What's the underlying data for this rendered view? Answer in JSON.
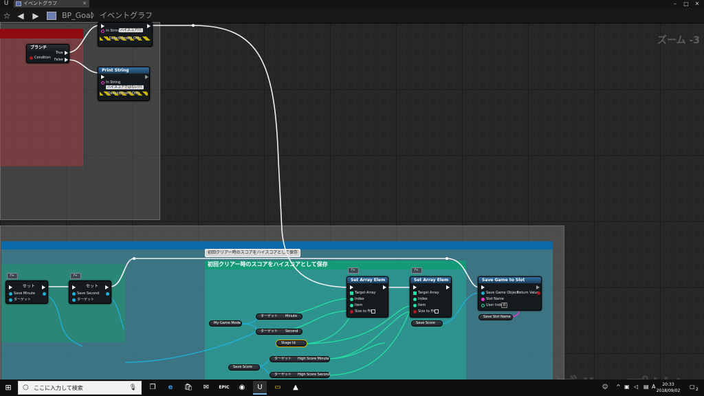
{
  "window": {
    "tab_title": "イベントグラフ",
    "breadcrumb": {
      "blueprint": "BP_Goal",
      "separator": "〉",
      "graph": "イベントグラフ"
    },
    "controls": {
      "minimize": "–",
      "maximize": "□",
      "close": "✕"
    }
  },
  "graph": {
    "zoom_label": "ズーム -3",
    "watermark": "ブループリント",
    "branch_node": {
      "title": "ブランチ",
      "condition": "Condition",
      "true": "True",
      "false": "False"
    },
    "print_string_top": {
      "in_string_label": "In String",
      "in_string_value": "ハイスコア!!!",
      "dev_only": "Development Only"
    },
    "print_string_bottom": {
      "title": "Print String",
      "in_string_label": "In String",
      "in_string_value": "ハイスコアではない!!!",
      "dev_only": "Development Only"
    },
    "comment": {
      "tooltip": "初回クリアー時のスコアをハイスコアとして保存",
      "title": "初回クリアー時のスコアをハイスコアとして保存"
    },
    "set_nodes": [
      {
        "badge": "f+",
        "title": "セット",
        "pin1": "Save Minute",
        "pin2": "ターゲット"
      },
      {
        "badge": "f+",
        "title": "セット",
        "pin1": "Save Second",
        "pin2": "ターゲット"
      }
    ],
    "set_array_nodes": [
      {
        "badge": "f+",
        "title": "Set Array Elem",
        "pins": [
          "Target Array",
          "Index",
          "Item",
          "Size to Fit"
        ]
      },
      {
        "badge": "f+",
        "title": "Set Array Elem",
        "pins": [
          "Target Array",
          "Index",
          "Item",
          "Size to Fit"
        ]
      }
    ],
    "save_game_node": {
      "title": "Save Game to Slot",
      "save_game_object": "Save Game Object",
      "return_value": "Return Value",
      "slot_name": "Slot Name",
      "user_index": "User Index",
      "user_index_value": "0"
    },
    "getters": {
      "my_game_mode": "My Game Mode",
      "target": "ターゲット",
      "minute": "Minute",
      "second": "Second",
      "stage_id": "Stage Id",
      "high_score_minute": "High Score Minute",
      "high_score_second": "High Score Second",
      "save_score_1": "Save Score",
      "save_score_2": "Save Score",
      "save_slot_name": "Save Slot Name"
    }
  },
  "taskbar": {
    "search_placeholder": "ここに入力して検索",
    "epic_label": "EPIC",
    "time": "20:33",
    "date": "2018/09/02",
    "notification_count": "2"
  }
}
